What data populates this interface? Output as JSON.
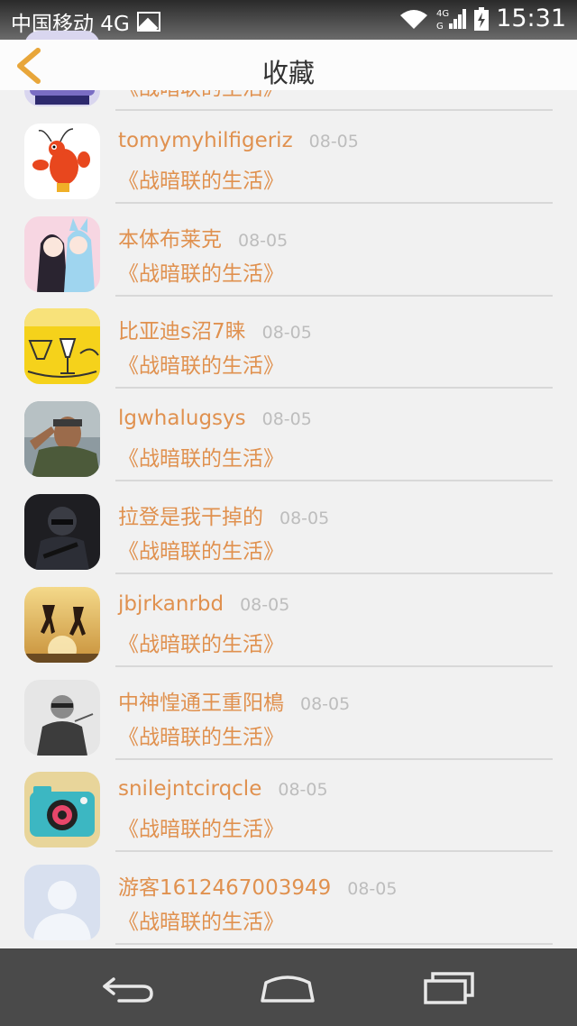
{
  "status_bar": {
    "carrier": "中国移动 4G",
    "network_badge_top": "4G",
    "network_badge_bottom": "G",
    "time": "15:31"
  },
  "header": {
    "title": "收藏"
  },
  "colors": {
    "accent": "#e0914f",
    "date": "#bdbdbd",
    "background": "#f1f1f1",
    "navbar": "#4a4a4a"
  },
  "favorites": [
    {
      "name": "",
      "date": "",
      "title": "《战暗联的生活》",
      "avatar": "partial-logo-avatar"
    },
    {
      "name": "tomymyhilfigeriz",
      "date": "08-05",
      "title": "《战暗联的生活》",
      "avatar": "cartoon-lobster-avatar"
    },
    {
      "name": "本体布莱克",
      "date": "08-05",
      "title": "《战暗联的生活》",
      "avatar": "anime-girls-avatar"
    },
    {
      "name": "比亚迪s沼7睐",
      "date": "08-05",
      "title": "《战暗联的生活》",
      "avatar": "yellow-cartoon-avatar"
    },
    {
      "name": "lgwhalugsys",
      "date": "08-05",
      "title": "《战暗联的生活》",
      "avatar": "soldier-salute-avatar"
    },
    {
      "name": "拉登是我干掉的",
      "date": "08-05",
      "title": "《战暗联的生活》",
      "avatar": "swat-soldier-avatar"
    },
    {
      "name": "jbjrkanrbd",
      "date": "08-05",
      "title": "《战暗联的生活》",
      "avatar": "jumping-silhouette-avatar"
    },
    {
      "name": "中神惶通王重阳樢",
      "date": "08-05",
      "title": "《战暗联的生活》",
      "avatar": "bw-woman-avatar"
    },
    {
      "name": "snilejntcirqcle",
      "date": "08-05",
      "title": "《战暗联的生活》",
      "avatar": "retro-camera-avatar"
    },
    {
      "name": "游客1612467003949",
      "date": "08-05",
      "title": "《战暗联的生活》",
      "avatar": "default-user-avatar"
    }
  ],
  "nav_bar": {
    "buttons": [
      "back-nav-icon",
      "home-nav-icon",
      "recents-nav-icon"
    ]
  }
}
